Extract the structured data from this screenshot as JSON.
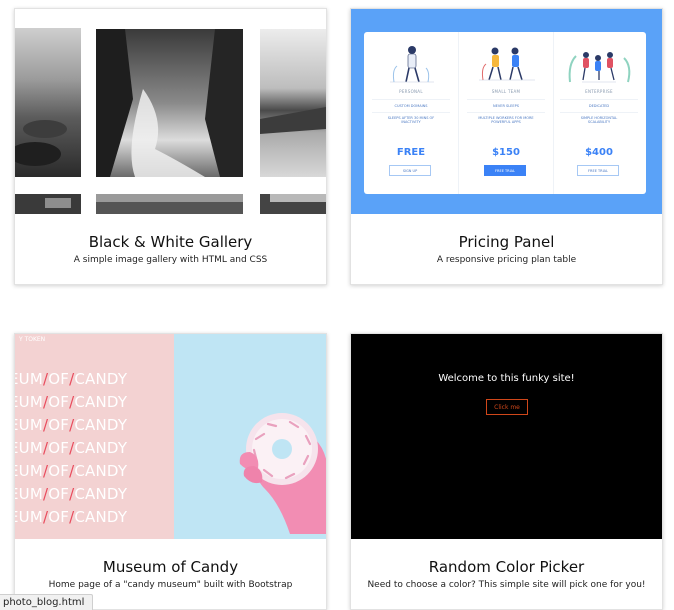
{
  "cards": [
    {
      "title": "Black & White Gallery",
      "description": "A simple image gallery with HTML and CSS"
    },
    {
      "title": "Pricing Panel",
      "description": "A responsive pricing plan table"
    },
    {
      "title": "Museum of Candy",
      "description": "Home page of a \"candy museum\" built with Bootstrap"
    },
    {
      "title": "Random Color Picker",
      "description": "Need to choose a color? This simple site will pick one for you!"
    }
  ],
  "pricing_preview": {
    "background_color": "#5aa2f8",
    "plans": [
      {
        "name": "PERSONAL",
        "features": [
          "CUSTOM DOMAINS",
          "SLEEPS AFTER 30 MINS OF INACTIVITY"
        ],
        "price": "FREE",
        "button": "SIGN UP"
      },
      {
        "name": "SMALL TEAM",
        "features": [
          "NEVER SLEEPS",
          "MULTIPLE WORKERS FOR MORE POWERFUL APPS"
        ],
        "price": "$150",
        "button": "FREE TRIAL"
      },
      {
        "name": "ENTERPRISE",
        "features": [
          "DEDICATED",
          "SIMPLE HORIZONTAL SCALABILITY"
        ],
        "price": "$400",
        "button": "FREE TRIAL"
      }
    ]
  },
  "candy_preview": {
    "small_text": "Y TOKEN",
    "row_text": [
      "EUM",
      "OF",
      "CANDY"
    ],
    "slash": "/"
  },
  "random_preview": {
    "welcome": "Welcome to this funky site!",
    "button": "Click me"
  },
  "status_bar": {
    "url": "photo_blog.html"
  }
}
